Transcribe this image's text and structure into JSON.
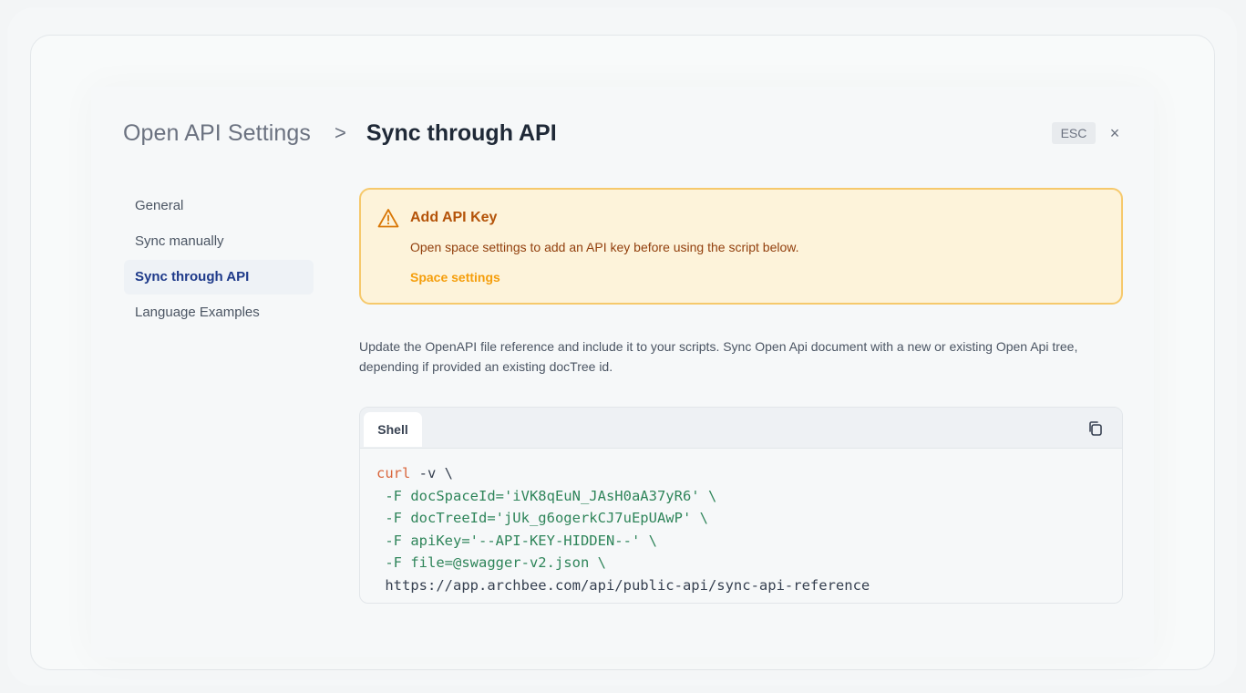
{
  "breadcrumb": {
    "parent": "Open API Settings",
    "separator": ">",
    "current": "Sync through API"
  },
  "header": {
    "esc_label": "ESC",
    "close_label": "×"
  },
  "sidebar": {
    "items": [
      {
        "label": "General",
        "active": false
      },
      {
        "label": "Sync manually",
        "active": false
      },
      {
        "label": "Sync through API",
        "active": true
      },
      {
        "label": "Language Examples",
        "active": false
      }
    ]
  },
  "alert": {
    "title": "Add API Key",
    "message": "Open space settings to add an API key before using the script below.",
    "link": "Space settings",
    "icon": "warning-triangle-icon",
    "accent_color": "#f6c96c"
  },
  "description": "Update the OpenAPI file reference and include it to your scripts. Sync Open Api document with a new or existing Open Api tree, depending if provided an existing docTree id.",
  "code": {
    "tab": "Shell",
    "copy_icon": "copy-icon",
    "lines": {
      "l1_cmd": "curl",
      "l1_rest": " -v \\",
      "l2": " -F docSpaceId='iVK8qEuN_JAsH0aA37yR6' \\",
      "l3": " -F docTreeId='jUk_g6ogerkCJ7uEpUAwP' \\",
      "l4": " -F apiKey='--API-KEY-HIDDEN--' \\",
      "l5": " -F file=@swagger-v2.json \\",
      "l6": " https://app.archbee.com/api/public-api/sync-api-reference"
    }
  }
}
